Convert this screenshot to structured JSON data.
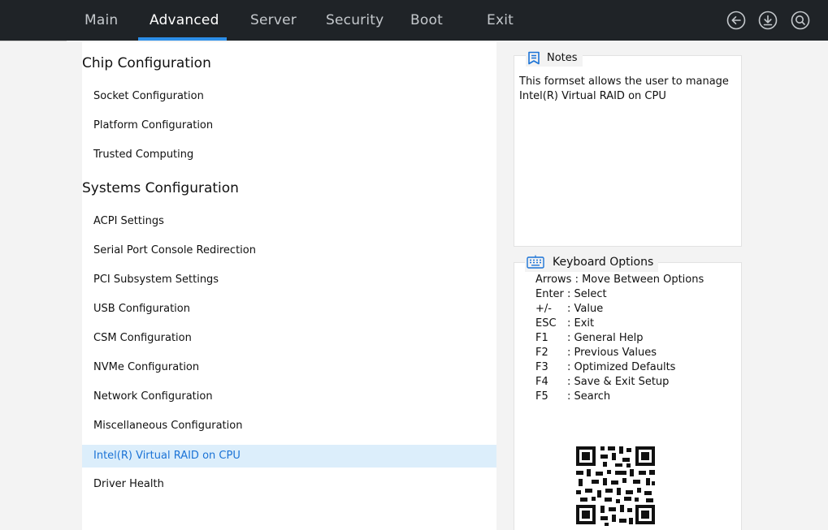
{
  "topbar": {
    "tabs": [
      {
        "label": "Main"
      },
      {
        "label": "Advanced"
      },
      {
        "label": "Server"
      },
      {
        "label": "Security"
      },
      {
        "label": "Boot"
      },
      {
        "label": "Exit"
      }
    ],
    "active_tab": "Advanced",
    "icons": [
      "back-arrow-icon",
      "download-icon",
      "search-icon"
    ],
    "accent_color": "#2c8ee8"
  },
  "menu": {
    "sections": [
      {
        "title": "Chip Configuration",
        "items": [
          "Socket Configuration",
          "Platform Configuration",
          "Trusted Computing"
        ]
      },
      {
        "title": "Systems Configuration",
        "items": [
          "ACPI Settings",
          "Serial Port Console Redirection",
          "PCI Subsystem Settings",
          "USB Configuration",
          "CSM Configuration",
          "NVMe Configuration",
          "Network Configuration",
          "Miscellaneous Configuration",
          "Intel(R) Virtual RAID on CPU",
          "Driver Health"
        ]
      }
    ],
    "selected_item": "Intel(R) Virtual RAID on CPU",
    "selected_color": "#1b73d6"
  },
  "notes": {
    "title": "Notes",
    "icon": "bookmark-icon",
    "text": "This formset allows the user to manage Intel(R) Virtual RAID on CPU"
  },
  "keyboard": {
    "title": "Keyboard Options",
    "icon": "keyboard-icon",
    "rows": [
      {
        "key": "Arrows",
        "desc": ": Move Between Options"
      },
      {
        "key": "Enter",
        "desc": ": Select"
      },
      {
        "key": "+/-",
        "desc": ": Value"
      },
      {
        "key": "ESC",
        "desc": ": Exit"
      },
      {
        "key": "F1",
        "desc": ": General Help"
      },
      {
        "key": "F2",
        "desc": ": Previous Values"
      },
      {
        "key": "F3",
        "desc": ": Optimized Defaults"
      },
      {
        "key": "F4",
        "desc": ": Save & Exit Setup"
      },
      {
        "key": "F5",
        "desc": ": Search"
      }
    ]
  },
  "qr": {
    "icon": "qr-code-icon"
  }
}
